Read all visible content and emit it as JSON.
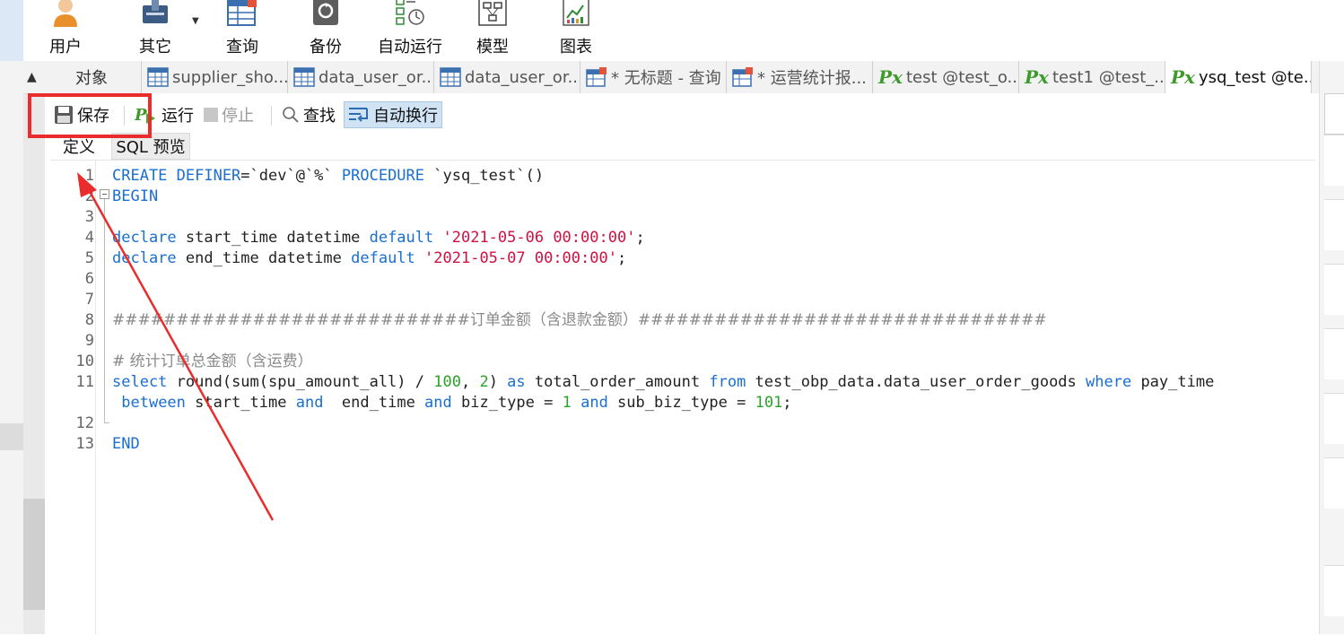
{
  "ribbon": {
    "items": [
      {
        "label": "用户",
        "icon": "user-icon"
      },
      {
        "label": "其它",
        "icon": "other-icon"
      },
      {
        "label": "查询",
        "icon": "query-icon"
      },
      {
        "label": "备份",
        "icon": "backup-icon"
      },
      {
        "label": "自动运行",
        "icon": "auto-run-icon"
      },
      {
        "label": "模型",
        "icon": "model-icon"
      },
      {
        "label": "图表",
        "icon": "chart-icon"
      }
    ]
  },
  "tabs": {
    "objects_label": "对象",
    "items": [
      {
        "label": "supplier_sho...",
        "icon": "table-icon",
        "active": false
      },
      {
        "label": "data_user_or...",
        "icon": "table-icon",
        "active": false
      },
      {
        "label": "data_user_or...",
        "icon": "table-icon",
        "active": false
      },
      {
        "label": "* 无标题 - 查询",
        "icon": "query-icon",
        "active": false
      },
      {
        "label": "* 运营统计报...",
        "icon": "query-icon",
        "active": false
      },
      {
        "label": "test @test_o...",
        "icon": "procedure-icon",
        "active": false
      },
      {
        "label": "test1 @test_...",
        "icon": "procedure-icon",
        "active": false
      },
      {
        "label": "ysq_test @te...",
        "icon": "procedure-icon",
        "active": true
      }
    ]
  },
  "toolbar": {
    "save_label": "保存",
    "run_label": "运行",
    "stop_label": "停止",
    "find_label": "查找",
    "wrap_label": "自动换行"
  },
  "subtabs": {
    "definition_label": "定义",
    "sql_preview_label": "SQL 预览"
  },
  "editor": {
    "lines": [
      {
        "n": "1",
        "tokens": [
          [
            "kw",
            "CREATE DEFINER"
          ],
          [
            "plain",
            "=`dev`@`%` "
          ],
          [
            "kw",
            "PROCEDURE"
          ],
          [
            "plain",
            " `ysq_test`()"
          ]
        ]
      },
      {
        "n": "2",
        "tokens": [
          [
            "kw",
            "BEGIN"
          ]
        ]
      },
      {
        "n": "3",
        "tokens": []
      },
      {
        "n": "4",
        "tokens": [
          [
            "kw",
            "declare"
          ],
          [
            "plain",
            " start_time datetime "
          ],
          [
            "kw",
            "default"
          ],
          [
            "plain",
            " "
          ],
          [
            "str",
            "'2021-05-06 00:00:00'"
          ],
          [
            "plain",
            ";"
          ]
        ]
      },
      {
        "n": "5",
        "tokens": [
          [
            "kw",
            "declare"
          ],
          [
            "plain",
            " end_time datetime "
          ],
          [
            "kw",
            "default"
          ],
          [
            "plain",
            " "
          ],
          [
            "str",
            "'2021-05-07 00:00:00'"
          ],
          [
            "plain",
            ";"
          ]
        ]
      },
      {
        "n": "6",
        "tokens": []
      },
      {
        "n": "7",
        "tokens": []
      },
      {
        "n": "8",
        "tokens": [
          [
            "cmt",
            "############################订单金额（含退款金额）################################"
          ]
        ]
      },
      {
        "n": "9",
        "tokens": []
      },
      {
        "n": "10",
        "tokens": [
          [
            "cmt",
            "# 统计订单总金额（含运费）"
          ]
        ]
      },
      {
        "n": "11",
        "tokens": [
          [
            "kw",
            "select"
          ],
          [
            "plain",
            " round(sum(spu_amount_all) / "
          ],
          [
            "num",
            "100"
          ],
          [
            "plain",
            ", "
          ],
          [
            "num",
            "2"
          ],
          [
            "plain",
            ") "
          ],
          [
            "kw",
            "as"
          ],
          [
            "plain",
            " total_order_amount "
          ],
          [
            "kw",
            "from"
          ],
          [
            "plain",
            " test_obp_data.data_user_order_goods "
          ],
          [
            "kw",
            "where"
          ],
          [
            "plain",
            " pay_time"
          ]
        ]
      },
      {
        "n": "",
        "tokens": [
          [
            "plain",
            " "
          ],
          [
            "kw",
            "between"
          ],
          [
            "plain",
            " start_time "
          ],
          [
            "kw",
            "and"
          ],
          [
            "plain",
            "  end_time "
          ],
          [
            "kw",
            "and"
          ],
          [
            "plain",
            " biz_type = "
          ],
          [
            "num",
            "1"
          ],
          [
            "plain",
            " "
          ],
          [
            "kw",
            "and"
          ],
          [
            "plain",
            " sub_biz_type = "
          ],
          [
            "num",
            "101"
          ],
          [
            "plain",
            ";"
          ]
        ]
      },
      {
        "n": "12",
        "tokens": []
      },
      {
        "n": "13",
        "tokens": [
          [
            "kw",
            "END"
          ]
        ]
      }
    ]
  },
  "colors": {
    "keyword": "#1a6fd0",
    "string": "#d01040",
    "number": "#2aa22a",
    "comment": "#8a8a8a",
    "highlight": "#ea2c2c"
  }
}
